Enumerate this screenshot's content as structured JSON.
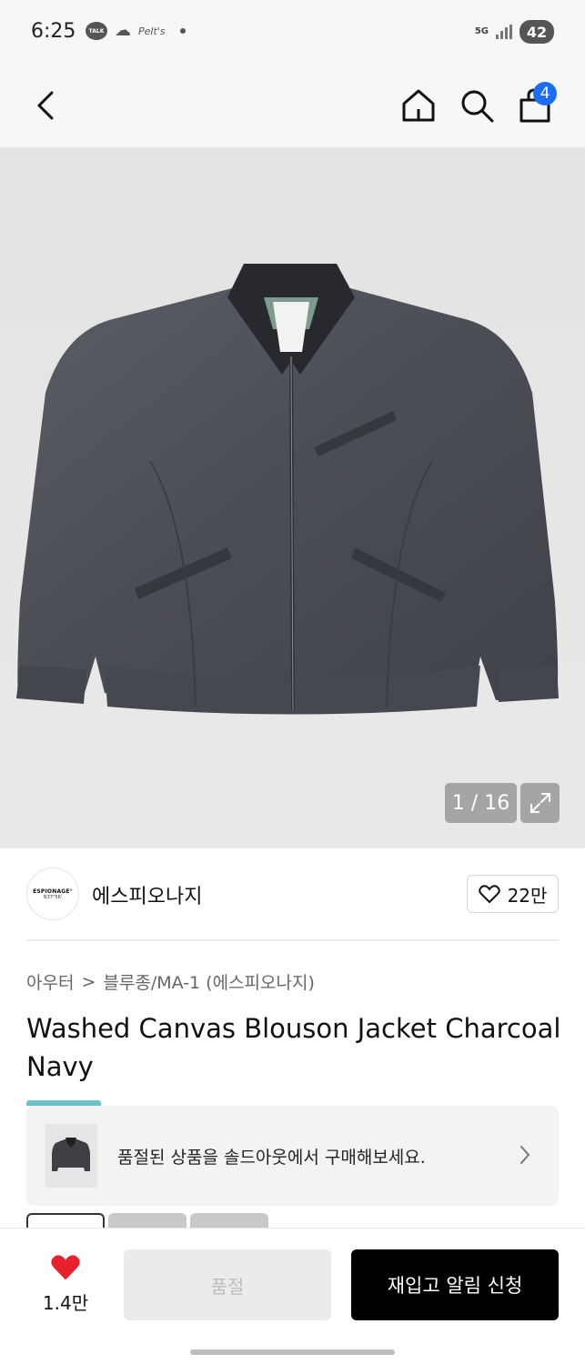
{
  "status_bar": {
    "time": "6:25",
    "talk_label": "TALK",
    "net_label": "Pelt's",
    "network": "5G",
    "battery": "42"
  },
  "header": {
    "cart_count": "4"
  },
  "gallery": {
    "counter": "1 / 16"
  },
  "brand": {
    "logo_line1": "ESPIONAGE°",
    "logo_line2": "N37°56'",
    "name": "에스피오나지",
    "likes": "22만"
  },
  "product": {
    "breadcrumb_category": "아우터",
    "breadcrumb_separator": ">",
    "breadcrumb_sub": "블루종/MA-1 (에스피오나지)",
    "title": "Washed Canvas Blouson Jacket Charcoal Navy"
  },
  "soldout_banner": {
    "text": "품절된 상품을 솔드아웃에서 구매해보세요."
  },
  "bottom_bar": {
    "wish_count": "1.4만",
    "soldout_label": "품절",
    "restock_label": "재입고 알림 신청"
  },
  "colors": {
    "accent_blue": "#1b6ef3",
    "heart_red": "#e8202e",
    "primary_black": "#000000"
  }
}
